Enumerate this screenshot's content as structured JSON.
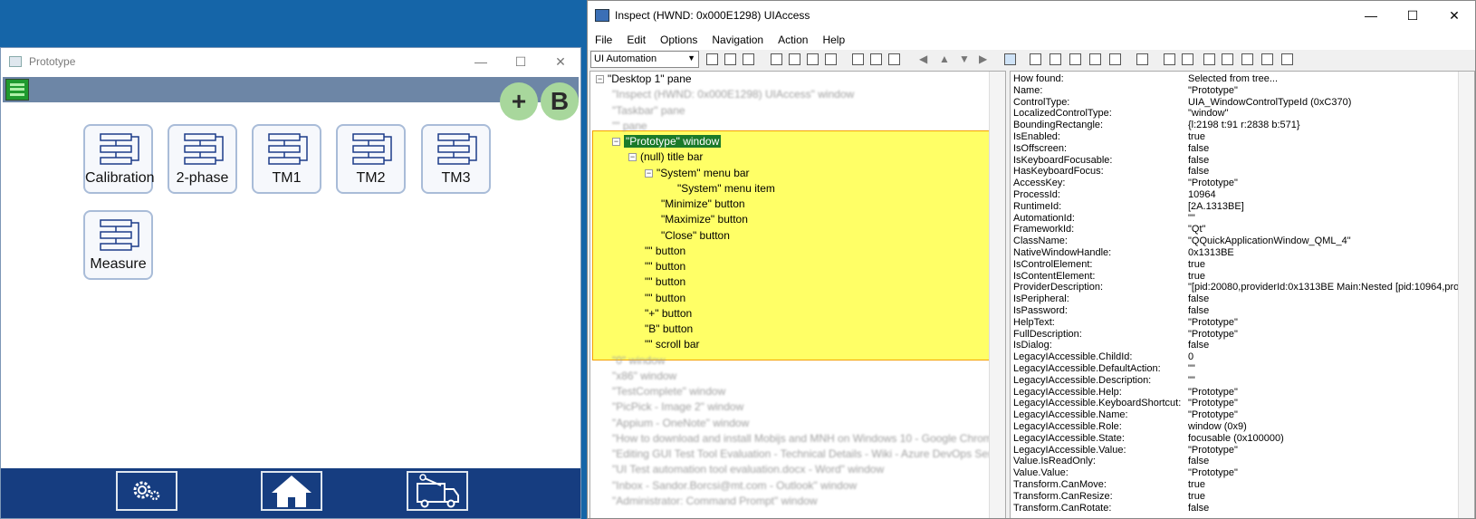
{
  "prototype": {
    "title": "Prototype",
    "window_controls": {
      "minimize": "—",
      "maximize": "☐",
      "close": "✕"
    },
    "plus_label": "+",
    "b_label": "B",
    "tiles": [
      {
        "label": "Calibration"
      },
      {
        "label": "2-phase"
      },
      {
        "label": "TM1"
      },
      {
        "label": "TM2"
      },
      {
        "label": "TM3"
      },
      {
        "label": "Measure"
      }
    ],
    "nav": [
      "settings-icon",
      "home-icon",
      "service-truck-icon"
    ]
  },
  "inspect": {
    "title": "Inspect  (HWND: 0x000E1298) UIAccess",
    "window_controls": {
      "minimize": "—",
      "maximize": "☐",
      "close": "✕"
    },
    "menu": [
      "File",
      "Edit",
      "Options",
      "Navigation",
      "Action",
      "Help"
    ],
    "mode": "UI Automation",
    "tree": {
      "root": "\"Desktop 1\" pane",
      "blurred_top": [
        "\"Inspect  (HWND: 0x000E1298) UIAccess\" window",
        "\"Taskbar\" pane",
        "\"\" pane"
      ],
      "selected": "\"Prototype\" window",
      "children": [
        {
          "text": "(null) title bar",
          "level": 1,
          "expander": "⊟"
        },
        {
          "text": "\"System\" menu bar",
          "level": 2,
          "expander": "⊟"
        },
        {
          "text": "\"System\" menu item",
          "level": 3,
          "expander": ""
        },
        {
          "text": "\"Minimize\" button",
          "level": 2,
          "expander": ""
        },
        {
          "text": "\"Maximize\" button",
          "level": 2,
          "expander": ""
        },
        {
          "text": "\"Close\" button",
          "level": 2,
          "expander": ""
        },
        {
          "text": "\"\" button",
          "level": 1,
          "expander": ""
        },
        {
          "text": "\"\" button",
          "level": 1,
          "expander": ""
        },
        {
          "text": "\"\" button",
          "level": 1,
          "expander": ""
        },
        {
          "text": "\"\" button",
          "level": 1,
          "expander": ""
        },
        {
          "text": "\"+\" button",
          "level": 1,
          "expander": ""
        },
        {
          "text": "\"B\" button",
          "level": 1,
          "expander": ""
        },
        {
          "text": "\"\" scroll bar",
          "level": 1,
          "expander": ""
        }
      ],
      "blurred_bottom": [
        "\"0\" window",
        "\"x86\" window",
        "\"TestComplete\" window",
        "\"PicPick - Image 2\" window",
        "\"Appium - OneNote\" window",
        "\"How to download and install Mobijs and MNH on Windows 10 - Google Chrome\" window",
        "\"Editing GUI Test Tool Evaluation - Technical Details - Wiki - Azure DevOps Services\"",
        "\"UI Test automation tool evaluation.docx - Word\" window",
        "\"Inbox - Sandor.Borcsi@mt.com - Outlook\" window",
        "\"Administrator: Command Prompt\" window"
      ]
    },
    "properties": [
      [
        "How found:",
        "Selected from tree..."
      ],
      [
        "Name:",
        "\"Prototype\""
      ],
      [
        "ControlType:",
        "UIA_WindowControlTypeId (0xC370)"
      ],
      [
        "LocalizedControlType:",
        "\"window\""
      ],
      [
        "BoundingRectangle:",
        "{l:2198 t:91 r:2838 b:571}"
      ],
      [
        "IsEnabled:",
        "true"
      ],
      [
        "IsOffscreen:",
        "false"
      ],
      [
        "IsKeyboardFocusable:",
        "false"
      ],
      [
        "HasKeyboardFocus:",
        "false"
      ],
      [
        "AccessKey:",
        "\"Prototype\""
      ],
      [
        "ProcessId:",
        "10964"
      ],
      [
        "RuntimeId:",
        "[2A.1313BE]"
      ],
      [
        "AutomationId:",
        "\"\""
      ],
      [
        "FrameworkId:",
        "\"Qt\""
      ],
      [
        "ClassName:",
        "\"QQuickApplicationWindow_QML_4\""
      ],
      [
        "NativeWindowHandle:",
        "0x1313BE"
      ],
      [
        "IsControlElement:",
        "true"
      ],
      [
        "IsContentElement:",
        "true"
      ],
      [
        "ProviderDescription:",
        "\"[pid:20080,providerId:0x1313BE Main:Nested [pid:10964,pro"
      ],
      [
        "IsPeripheral:",
        "false"
      ],
      [
        "IsPassword:",
        "false"
      ],
      [
        "HelpText:",
        "\"Prototype\""
      ],
      [
        "FullDescription:",
        "\"Prototype\""
      ],
      [
        "IsDialog:",
        "false"
      ],
      [
        "LegacyIAccessible.ChildId:",
        "0"
      ],
      [
        "LegacyIAccessible.DefaultAction:",
        "\"\""
      ],
      [
        "LegacyIAccessible.Description:",
        "\"\""
      ],
      [
        "LegacyIAccessible.Help:",
        "\"Prototype\""
      ],
      [
        "LegacyIAccessible.KeyboardShortcut:",
        "\"Prototype\""
      ],
      [
        "LegacyIAccessible.Name:",
        "\"Prototype\""
      ],
      [
        "LegacyIAccessible.Role:",
        "window (0x9)"
      ],
      [
        "LegacyIAccessible.State:",
        "focusable (0x100000)"
      ],
      [
        "LegacyIAccessible.Value:",
        "\"Prototype\""
      ],
      [
        "Value.IsReadOnly:",
        "false"
      ],
      [
        "Value.Value:",
        "\"Prototype\""
      ],
      [
        "Transform.CanMove:",
        "true"
      ],
      [
        "Transform.CanResize:",
        "true"
      ],
      [
        "Transform.CanRotate:",
        "false"
      ]
    ]
  }
}
